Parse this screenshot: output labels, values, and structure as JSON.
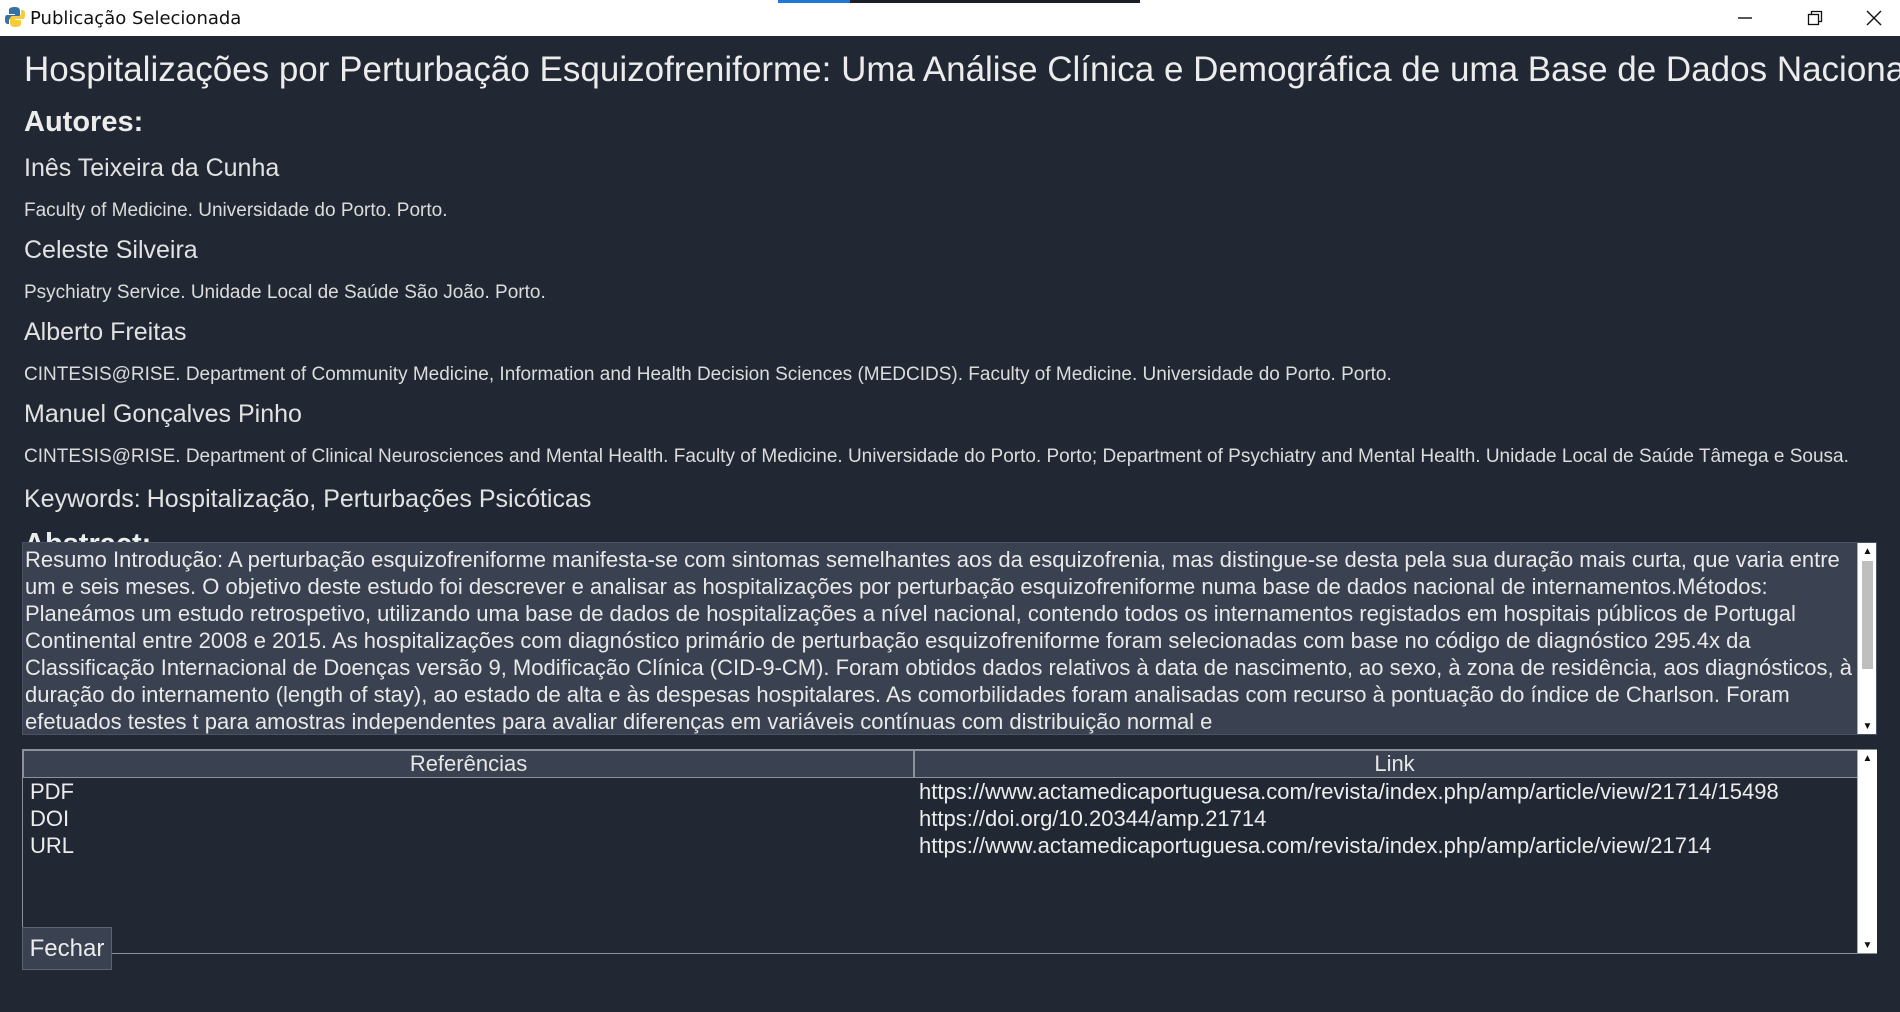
{
  "window": {
    "title": "Publicação Selecionada",
    "icon": "python-icon",
    "controls": [
      "minimize-icon",
      "restore-icon",
      "close-icon"
    ]
  },
  "publication": {
    "title": "Hospitalizações por Perturbação Esquizofreniforme: Uma Análise Clínica e Demográfica de uma Base de Dados Nacional",
    "authors_heading": "Autores:",
    "authors": [
      {
        "name": "Inês Teixeira da Cunha",
        "affiliation": "Faculty of Medicine. Universidade do Porto. Porto."
      },
      {
        "name": "Celeste Silveira",
        "affiliation": "Psychiatry Service. Unidade Local de Saúde São João. Porto."
      },
      {
        "name": "Alberto Freitas",
        "affiliation": "CINTESIS@RISE. Department of Community Medicine, Information and Health Decision Sciences (MEDCIDS). Faculty of Medicine. Universidade do Porto. Porto."
      },
      {
        "name": "Manuel Gonçalves Pinho",
        "affiliation": "CINTESIS@RISE. Department of Clinical Neurosciences and Mental Health. Faculty of Medicine. Universidade do Porto. Porto; Department of Psychiatry and Mental Health. Unidade Local de Saúde Tâmega e Sousa."
      }
    ],
    "keywords_label": "Keywords:",
    "keywords": "Hospitalização, Perturbações Psicóticas",
    "abstract_heading": "Abstract:",
    "abstract": "Resumo Introdução: A perturbação esquizofreniforme manifesta-se com sintomas semelhantes aos da esquizofrenia, mas distingue-se desta pela sua duração mais curta, que varia entre um e seis meses. O objetivo deste estudo foi descrever e analisar as hospitalizações por perturbação esquizofreniforme numa base de dados nacional de internamentos.Métodos: Planeámos um estudo retrospetivo, utilizando uma base de dados de hospitalizações a nível nacional, contendo todos os internamentos registados em hospitais públicos de Portugal Continental entre 2008 e 2015. As hospitalizações com diagnóstico primário de perturbação esquizofreniforme foram selecionadas com base no código de diagnóstico 295.4x da Classificação Internacional de Doenças versão 9, Modificação Clínica (CID-9-CM). Foram obtidos dados relativos à data de nascimento, ao sexo, à zona de residência, aos diagnósticos, à duração do internamento (length of stay), ao estado de alta e às despesas hospitalares. As comorbilidades foram analisadas com recurso à pontuação do índice de Charlson. Foram efetuados testes t para amostras independentes para avaliar diferenças em variáveis contínuas com distribuição normal e"
  },
  "references_table": {
    "columns": [
      "Referências",
      "Link"
    ],
    "rows": [
      {
        "ref": "PDF",
        "link": "https://www.actamedicaportuguesa.com/revista/index.php/amp/article/view/21714/15498"
      },
      {
        "ref": "DOI",
        "link": "https://doi.org/10.20344/amp.21714"
      },
      {
        "ref": "URL",
        "link": "https://www.actamedicaportuguesa.com/revista/index.php/amp/article/view/21714"
      }
    ]
  },
  "buttons": {
    "close_label": "Fechar"
  },
  "colors": {
    "background": "#212833",
    "panel": "#3a4150",
    "title_accent_blue": "#1e78d6"
  }
}
